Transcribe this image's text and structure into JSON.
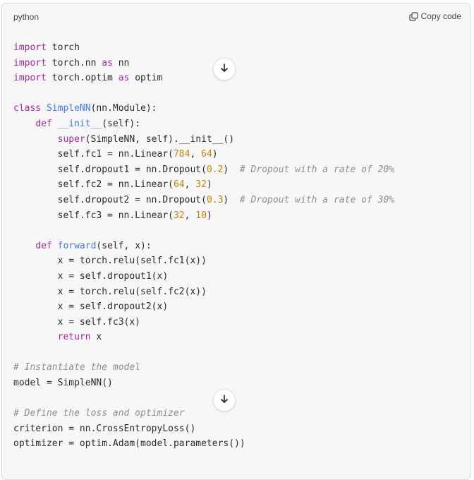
{
  "header": {
    "language": "python",
    "copy_label": "Copy code"
  },
  "icons": {
    "copy": "copy-icon",
    "scroll_down": "arrow-down-icon"
  },
  "code_lines": [
    [
      {
        "t": "import",
        "c": "kw"
      },
      {
        "t": " torch",
        "c": "tx"
      }
    ],
    [
      {
        "t": "import",
        "c": "kw"
      },
      {
        "t": " torch.nn ",
        "c": "tx"
      },
      {
        "t": "as",
        "c": "kw"
      },
      {
        "t": " nn",
        "c": "tx"
      }
    ],
    [
      {
        "t": "import",
        "c": "kw"
      },
      {
        "t": " torch.optim ",
        "c": "tx"
      },
      {
        "t": "as",
        "c": "kw"
      },
      {
        "t": " optim",
        "c": "tx"
      }
    ],
    [],
    [
      {
        "t": "class",
        "c": "kw"
      },
      {
        "t": " ",
        "c": "tx"
      },
      {
        "t": "SimpleNN",
        "c": "fn"
      },
      {
        "t": "(nn.Module):",
        "c": "tx"
      }
    ],
    [
      {
        "t": "    ",
        "c": "tx"
      },
      {
        "t": "def",
        "c": "kw"
      },
      {
        "t": " ",
        "c": "tx"
      },
      {
        "t": "__init__",
        "c": "fn"
      },
      {
        "t": "(self):",
        "c": "tx"
      }
    ],
    [
      {
        "t": "        ",
        "c": "tx"
      },
      {
        "t": "super",
        "c": "kw"
      },
      {
        "t": "(SimpleNN, self).__init__()",
        "c": "tx"
      }
    ],
    [
      {
        "t": "        self.fc1 = nn.Linear(",
        "c": "tx"
      },
      {
        "t": "784",
        "c": "num"
      },
      {
        "t": ", ",
        "c": "tx"
      },
      {
        "t": "64",
        "c": "num"
      },
      {
        "t": ")",
        "c": "tx"
      }
    ],
    [
      {
        "t": "        self.dropout1 = nn.Dropout(",
        "c": "tx"
      },
      {
        "t": "0.2",
        "c": "num"
      },
      {
        "t": ")  ",
        "c": "tx"
      },
      {
        "t": "# Dropout with a rate of 20%",
        "c": "cm"
      }
    ],
    [
      {
        "t": "        self.fc2 = nn.Linear(",
        "c": "tx"
      },
      {
        "t": "64",
        "c": "num"
      },
      {
        "t": ", ",
        "c": "tx"
      },
      {
        "t": "32",
        "c": "num"
      },
      {
        "t": ")",
        "c": "tx"
      }
    ],
    [
      {
        "t": "        self.dropout2 = nn.Dropout(",
        "c": "tx"
      },
      {
        "t": "0.3",
        "c": "num"
      },
      {
        "t": ")  ",
        "c": "tx"
      },
      {
        "t": "# Dropout with a rate of 30%",
        "c": "cm"
      }
    ],
    [
      {
        "t": "        self.fc3 = nn.Linear(",
        "c": "tx"
      },
      {
        "t": "32",
        "c": "num"
      },
      {
        "t": ", ",
        "c": "tx"
      },
      {
        "t": "10",
        "c": "num"
      },
      {
        "t": ")",
        "c": "tx"
      }
    ],
    [],
    [
      {
        "t": "    ",
        "c": "tx"
      },
      {
        "t": "def",
        "c": "kw"
      },
      {
        "t": " ",
        "c": "tx"
      },
      {
        "t": "forward",
        "c": "fn"
      },
      {
        "t": "(self, x):",
        "c": "tx"
      }
    ],
    [
      {
        "t": "        x = torch.relu(self.fc1(x))",
        "c": "tx"
      }
    ],
    [
      {
        "t": "        x = self.dropout1(x)",
        "c": "tx"
      }
    ],
    [
      {
        "t": "        x = torch.relu(self.fc2(x))",
        "c": "tx"
      }
    ],
    [
      {
        "t": "        x = self.dropout2(x)",
        "c": "tx"
      }
    ],
    [
      {
        "t": "        x = self.fc3(x)",
        "c": "tx"
      }
    ],
    [
      {
        "t": "        ",
        "c": "tx"
      },
      {
        "t": "return",
        "c": "kw"
      },
      {
        "t": " x",
        "c": "tx"
      }
    ],
    [],
    [
      {
        "t": "# Instantiate the model",
        "c": "cm"
      }
    ],
    [
      {
        "t": "model = SimpleNN()",
        "c": "tx"
      }
    ],
    [],
    [
      {
        "t": "# Define the loss and optimizer",
        "c": "cm"
      }
    ],
    [
      {
        "t": "criterion = nn.CrossEntropyLoss()",
        "c": "tx"
      }
    ],
    [
      {
        "t": "optimizer = optim.Adam(model.parameters())",
        "c": "tx"
      }
    ]
  ]
}
